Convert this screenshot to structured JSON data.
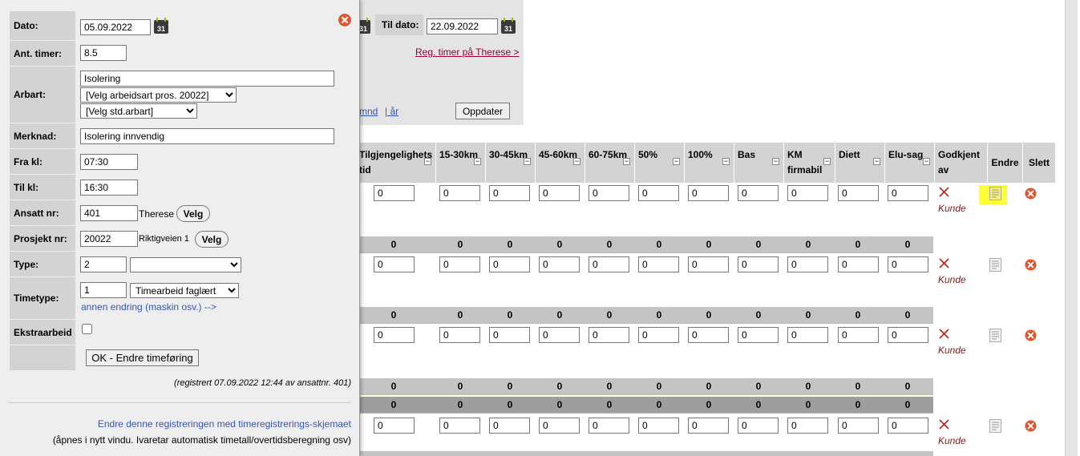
{
  "header": {
    "til_dato_label": "Til dato:",
    "til_dato_value": "22.09.2022",
    "reg_link": "Reg. timer på Therese >",
    "period_links": [
      " mnd",
      "| år"
    ],
    "oppdater_label": "Oppdater"
  },
  "table": {
    "columns": [
      {
        "label": "Tilgjengelighetstid"
      },
      {
        "label": "15-30km"
      },
      {
        "label": "30-45km"
      },
      {
        "label": "45-60km"
      },
      {
        "label": "60-75km"
      },
      {
        "label": "50%"
      },
      {
        "label": "100%"
      },
      {
        "label": "Bas"
      },
      {
        "label": "KM firmabil"
      },
      {
        "label": "Diett"
      },
      {
        "label": "Elu-sag"
      }
    ],
    "godkjent_label": "Godkjent av",
    "endre_label": "Endre",
    "slett_label": "Slett",
    "input_value": "0",
    "sum_value": "0",
    "approved_by": "Kunde"
  },
  "popup": {
    "dato_label": "Dato:",
    "dato_value": "05.09.2022",
    "timer_label": "Ant. timer:",
    "timer_value": "8.5",
    "arbart_label": "Arbart:",
    "arbart_value": "Isolering",
    "arbart_select1": "[Velg arbeidsart pros. 20022]",
    "arbart_select2": "[Velg std.arbart]",
    "merknad_label": "Merknad:",
    "merknad_value": "Isolering innvendig",
    "fra_label": "Fra kl:",
    "fra_value": "07:30",
    "til_label": "Til kl:",
    "til_value": "16:30",
    "ansatt_label": "Ansatt nr:",
    "ansatt_value": "401",
    "ansatt_name": "Therese",
    "prosjekt_label": "Prosjekt nr:",
    "prosjekt_value": "20022",
    "prosjekt_name": "Riktigveien 1",
    "velg_label": "Velg",
    "type_label": "Type:",
    "type_value": "2",
    "type_select": "",
    "timetype_label": "Timetype:",
    "timetype_value": "1",
    "timetype_select": "Timearbeid faglært",
    "annen_link": "annen endring (maskin osv.) -->",
    "ekstra_label": "Ekstraarbeid",
    "ok_label": "OK - Endre timeføring",
    "registered": "(registrert 07.09.2022 12:44 av ansattnr. 401)",
    "endre_link": "Endre denne registreringen med timeregistrerings-skjemaet",
    "endre_note": "(åpnes i nytt vindu. Ivaretar automatisk timetall/overtidsberegning osv)"
  },
  "icons": {
    "calendar_day": "31",
    "close": "close-icon",
    "delete": "delete-icon",
    "edit": "edit-icon",
    "reject": "x-mark-icon"
  },
  "colors": {
    "accent_red": "#e8542a",
    "link_blue": "#3355bb",
    "link_maroon": "#990033",
    "highlight": "#ffff33"
  }
}
